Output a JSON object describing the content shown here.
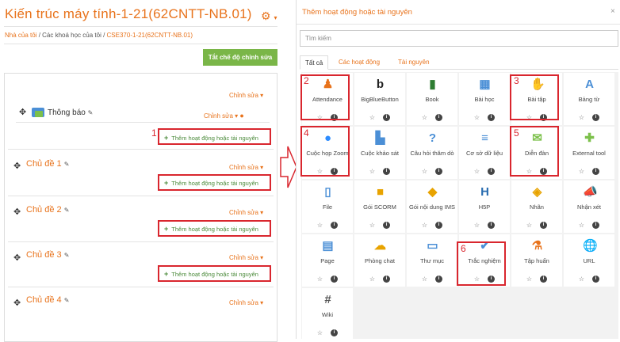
{
  "course": {
    "title": "Kiến trúc máy tính-1-21(62CNTT-NB.01)",
    "breadcrumb": [
      "Nhà của tôi",
      "Các khoá học của tôi",
      "CSE370-1-21(62CNTT-NB.01)"
    ],
    "edit_mode_button": "Tắt chế độ chỉnh sửa",
    "edit_label": "Chỉnh sửa",
    "edit_caret": "▾",
    "news_label": "Thông báo",
    "add_activity_label": "Thêm hoạt động hoặc tài nguyên",
    "sections": [
      "Chủ đề 1",
      "Chủ đề 2",
      "Chủ đề 3",
      "Chủ đề 4"
    ]
  },
  "modal": {
    "title": "Thêm hoạt động hoặc tài nguyên",
    "close": "×",
    "search_placeholder": "Tìm kiếm",
    "tabs": [
      "Tất cả",
      "Các hoạt động",
      "Tài nguyên"
    ],
    "items": [
      {
        "label": "Attendance",
        "icon": "attendance-icon"
      },
      {
        "label": "BigBlueButton",
        "icon": "bigbluebutton-icon"
      },
      {
        "label": "Book",
        "icon": "book-icon"
      },
      {
        "label": "Bài học",
        "icon": "lesson-icon"
      },
      {
        "label": "Bài tập",
        "icon": "assignment-icon"
      },
      {
        "label": "Bảng từ",
        "icon": "glossary-icon"
      },
      {
        "label": "Cuộc họp Zoom",
        "icon": "zoom-icon"
      },
      {
        "label": "Cuộc khảo sát",
        "icon": "survey-icon"
      },
      {
        "label": "Câu hỏi thăm dò",
        "icon": "choice-icon"
      },
      {
        "label": "Cơ sở dữ liệu",
        "icon": "database-icon"
      },
      {
        "label": "Diễn đàn",
        "icon": "forum-icon"
      },
      {
        "label": "External tool",
        "icon": "external-tool-icon"
      },
      {
        "label": "File",
        "icon": "file-icon"
      },
      {
        "label": "Gói SCORM",
        "icon": "scorm-icon"
      },
      {
        "label": "Gói nội dung IMS",
        "icon": "ims-icon"
      },
      {
        "label": "H5P",
        "icon": "h5p-icon"
      },
      {
        "label": "Nhãn",
        "icon": "label-icon"
      },
      {
        "label": "Nhận xét",
        "icon": "feedback-icon"
      },
      {
        "label": "Page",
        "icon": "page-icon"
      },
      {
        "label": "Phòng chat",
        "icon": "chat-icon"
      },
      {
        "label": "Thư mục",
        "icon": "folder-icon"
      },
      {
        "label": "Trắc nghiệm",
        "icon": "quiz-icon"
      },
      {
        "label": "Tập huấn",
        "icon": "workshop-icon"
      },
      {
        "label": "URL",
        "icon": "url-icon"
      },
      {
        "label": "Wiki",
        "icon": "wiki-icon"
      }
    ]
  },
  "annotations": [
    "1",
    "2",
    "3",
    "4",
    "5",
    "6"
  ],
  "colors": {
    "accent": "#e8731c",
    "green": "#7ab648",
    "red": "#d9262e"
  }
}
